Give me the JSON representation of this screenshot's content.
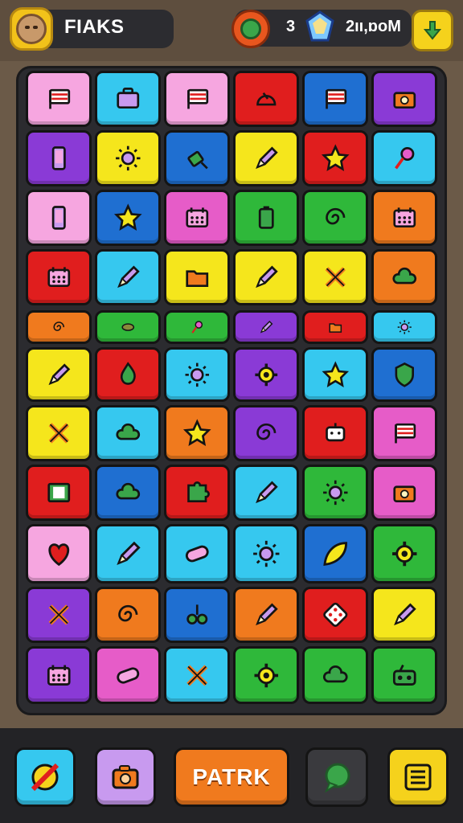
{
  "header": {
    "player_name": "FIAKS",
    "currency_count": "3",
    "currency_amount": "2ıı,ɒoM",
    "icons": [
      "avatar-icon",
      "globe-icon",
      "gem-icon",
      "download-icon"
    ]
  },
  "board": {
    "rows": 11,
    "cols": 6,
    "tiles": [
      [
        {
          "bg": "#f6a6e0",
          "icon": "flag"
        },
        {
          "bg": "#36c8ef",
          "icon": "briefcase"
        },
        {
          "bg": "#f6a6e0",
          "icon": "flag"
        },
        {
          "bg": "#e01e1e",
          "icon": "helmet"
        },
        {
          "bg": "#1f6fd1",
          "icon": "flag"
        },
        {
          "bg": "#8a3ad6",
          "icon": "camera"
        }
      ],
      [
        {
          "bg": "#8a3ad6",
          "icon": "phone"
        },
        {
          "bg": "#f5e61c",
          "icon": "sun"
        },
        {
          "bg": "#1f6fd1",
          "icon": "plug"
        },
        {
          "bg": "#f5e61c",
          "icon": "pen"
        },
        {
          "bg": "#e01e1e",
          "icon": "star"
        },
        {
          "bg": "#36c8ef",
          "icon": "pin"
        }
      ],
      [
        {
          "bg": "#f6a6e0",
          "icon": "phone"
        },
        {
          "bg": "#1f6fd1",
          "icon": "star"
        },
        {
          "bg": "#e65cc8",
          "icon": "calendar"
        },
        {
          "bg": "#2fb83a",
          "icon": "battery"
        },
        {
          "bg": "#2fb83a",
          "icon": "swirl"
        },
        {
          "bg": "#f07a1e",
          "icon": "calendar"
        }
      ],
      [
        {
          "bg": "#e01e1e",
          "icon": "calendar"
        },
        {
          "bg": "#36c8ef",
          "icon": "pen"
        },
        {
          "bg": "#f5e61c",
          "icon": "folder"
        },
        {
          "bg": "#f5e61c",
          "icon": "pen"
        },
        {
          "bg": "#f5e61c",
          "icon": "cross"
        },
        {
          "bg": "#f07a1e",
          "icon": "cloud"
        }
      ],
      [
        {
          "bg": "#f07a1e",
          "icon": "swirl"
        },
        {
          "bg": "#2fb83a",
          "icon": "disc"
        },
        {
          "bg": "#2fb83a",
          "icon": "pin"
        },
        {
          "bg": "#8a3ad6",
          "icon": "pen"
        },
        {
          "bg": "#e01e1e",
          "icon": "folder"
        },
        {
          "bg": "#36c8ef",
          "icon": "sun"
        }
      ],
      [
        {
          "bg": "#f5e61c",
          "icon": "pen"
        },
        {
          "bg": "#e01e1e",
          "icon": "flame"
        },
        {
          "bg": "#36c8ef",
          "icon": "sun"
        },
        {
          "bg": "#8a3ad6",
          "icon": "gear"
        },
        {
          "bg": "#36c8ef",
          "icon": "star"
        },
        {
          "bg": "#1f6fd1",
          "icon": "shield"
        }
      ],
      [
        {
          "bg": "#f5e61c",
          "icon": "cross"
        },
        {
          "bg": "#36c8ef",
          "icon": "cloud"
        },
        {
          "bg": "#f07a1e",
          "icon": "star"
        },
        {
          "bg": "#8a3ad6",
          "icon": "swirl"
        },
        {
          "bg": "#e01e1e",
          "icon": "robot"
        },
        {
          "bg": "#e65cc8",
          "icon": "flag"
        }
      ],
      [
        {
          "bg": "#e01e1e",
          "icon": "film"
        },
        {
          "bg": "#1f6fd1",
          "icon": "cloud"
        },
        {
          "bg": "#e01e1e",
          "icon": "puzzle"
        },
        {
          "bg": "#36c8ef",
          "icon": "pen"
        },
        {
          "bg": "#2fb83a",
          "icon": "sun"
        },
        {
          "bg": "#e65cc8",
          "icon": "camera"
        }
      ],
      [
        {
          "bg": "#f6a6e0",
          "icon": "heart"
        },
        {
          "bg": "#36c8ef",
          "icon": "pen"
        },
        {
          "bg": "#36c8ef",
          "icon": "pill"
        },
        {
          "bg": "#36c8ef",
          "icon": "sun"
        },
        {
          "bg": "#1f6fd1",
          "icon": "leaf"
        },
        {
          "bg": "#2fb83a",
          "icon": "gear"
        }
      ],
      [
        {
          "bg": "#8a3ad6",
          "icon": "cross"
        },
        {
          "bg": "#f07a1e",
          "icon": "swirl"
        },
        {
          "bg": "#1f6fd1",
          "icon": "glasses"
        },
        {
          "bg": "#f07a1e",
          "icon": "pen"
        },
        {
          "bg": "#e01e1e",
          "icon": "dice"
        },
        {
          "bg": "#f5e61c",
          "icon": "pen"
        }
      ],
      [
        {
          "bg": "#8a3ad6",
          "icon": "calendar"
        },
        {
          "bg": "#e65cc8",
          "icon": "pill"
        },
        {
          "bg": "#36c8ef",
          "icon": "cross"
        },
        {
          "bg": "#2fb83a",
          "icon": "gear"
        },
        {
          "bg": "#2fb83a",
          "icon": "cloud"
        },
        {
          "bg": "#2fb83a",
          "icon": "radio"
        }
      ]
    ]
  },
  "footer": {
    "play_label": "PATRK",
    "buttons": [
      {
        "icon": "no-icon",
        "bg": "#36c8ef"
      },
      {
        "icon": "camera-icon",
        "bg": "#c89aef"
      },
      {
        "icon": "chat-icon",
        "bg": "#3a3a3e"
      },
      {
        "icon": "menu-icon",
        "bg": "#f5d21c"
      }
    ]
  }
}
